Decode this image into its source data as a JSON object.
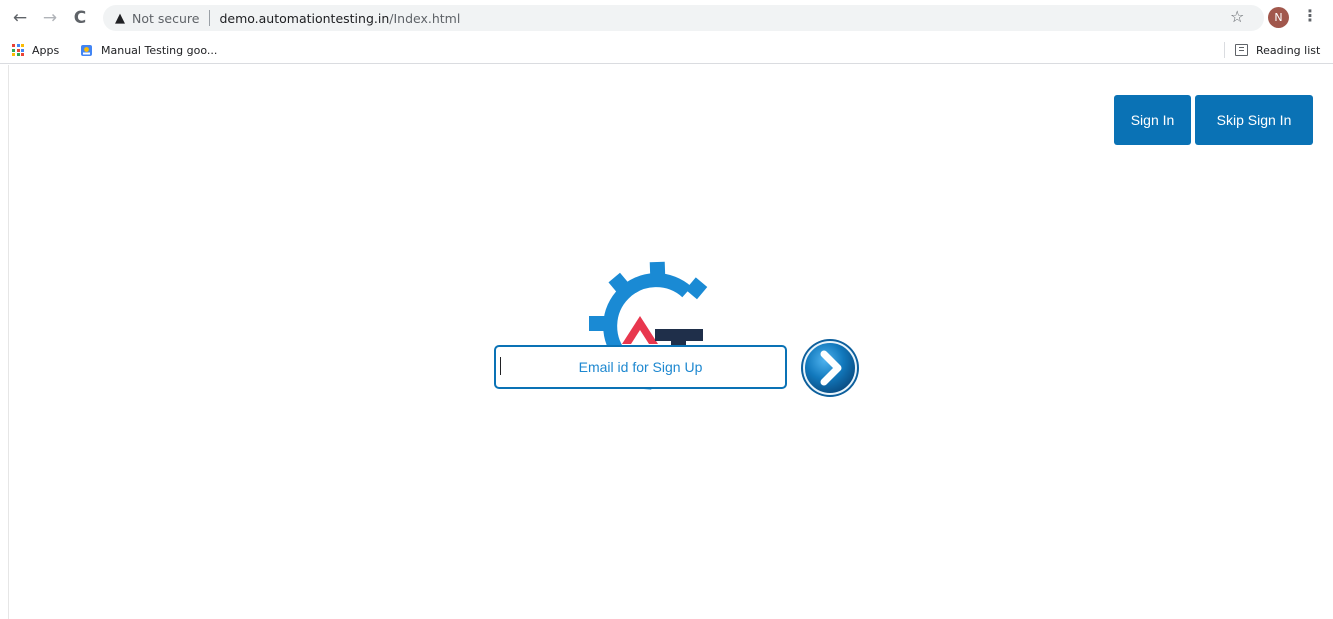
{
  "browser": {
    "back_icon": "←",
    "forward_icon": "→",
    "reload_icon": "C",
    "security_icon": "▲",
    "security_label": "Not secure",
    "url_host": "demo.automationtesting.in",
    "url_path": "/Index.html",
    "star_icon": "☆",
    "profile_initial": "N",
    "menu_icon": "⋮"
  },
  "bookmarks": {
    "apps_label": "Apps",
    "items": [
      {
        "label": "Manual Testing goo..."
      }
    ],
    "reading_list_label": "Reading list"
  },
  "header": {
    "sign_in_label": "Sign In",
    "skip_sign_in_label": "Skip Sign In"
  },
  "signup": {
    "email_placeholder": "Email id for Sign Up",
    "email_value": ""
  },
  "colors": {
    "accent": "#0a72b5",
    "logo_gear": "#1a8ad4",
    "logo_a": "#e8374e",
    "logo_t": "#1f2f4a"
  }
}
